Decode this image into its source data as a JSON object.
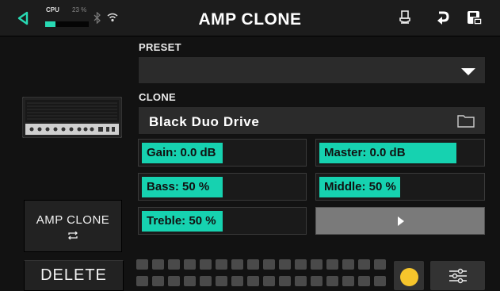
{
  "header": {
    "title": "AMP CLONE",
    "cpu_label": "CPU",
    "cpu_percent_text": "23 %",
    "cpu_load": 0.23,
    "icons": [
      "back-icon",
      "bluetooth-icon",
      "wifi-icon",
      "tuner-icon",
      "undo-icon",
      "save-icon"
    ]
  },
  "left": {
    "amp_clone_button_label": "AMP CLONE",
    "amp_clone_button_icon": "swap-icon",
    "delete_button_label": "DELETE"
  },
  "preset": {
    "label": "PRESET",
    "value": ""
  },
  "clone": {
    "label": "CLONE",
    "name": "Black Duo Drive",
    "icon": "folder-icon"
  },
  "params": {
    "gain": {
      "label": "Gain: 0.0 dB",
      "level": 0.5
    },
    "master": {
      "label": "Master: 0.0 dB",
      "level": 0.85
    },
    "bass": {
      "label": "Bass: 50 %",
      "level": 0.5
    },
    "middle": {
      "label": "Middle: 50 %",
      "level": 0.5
    },
    "treble": {
      "label": "Treble: 50 %",
      "level": 0.5
    }
  },
  "next_page_icon": "play-icon",
  "bottom": {
    "indicator_color": "#f6c52c",
    "settings_icon": "sliders-icon"
  },
  "colors": {
    "accent": "#16d2b0",
    "background": "#121212"
  }
}
